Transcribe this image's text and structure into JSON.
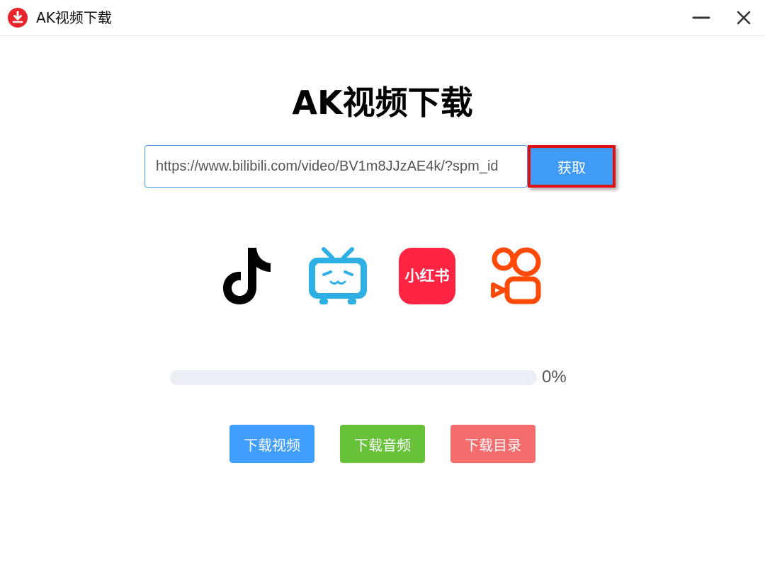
{
  "window": {
    "title": "AK视频下载",
    "icons": {
      "app": "download-circle-icon",
      "minimize": "minimize-icon",
      "close": "close-icon"
    },
    "app_icon_color": "#e8232b"
  },
  "main": {
    "title": "AK视频下载",
    "url_input": {
      "value": "https://www.bilibili.com/video/BV1m8JJzAE4k/?spm_id"
    },
    "fetch_label": "获取"
  },
  "platforms": [
    {
      "name": "tiktok",
      "icon": "tiktok-logo-icon",
      "color": "#000000"
    },
    {
      "name": "bilibili",
      "icon": "bilibili-tv-icon",
      "color": "#2fb0e5"
    },
    {
      "name": "xiaohongshu",
      "icon": "xiaohongshu-logo-icon",
      "label": "小红书",
      "color": "#fe2442"
    },
    {
      "name": "kuaishou",
      "icon": "kuaishou-logo-icon",
      "color": "#ff4906"
    }
  ],
  "progress": {
    "value": 0,
    "text": "0%"
  },
  "actions": {
    "download_video": "下载视频",
    "download_audio": "下载音频",
    "download_dir": "下载目录"
  },
  "colors": {
    "accent": "#409eff",
    "success": "#67c23a",
    "danger": "#f56c6c",
    "highlight_border": "#e01010"
  }
}
